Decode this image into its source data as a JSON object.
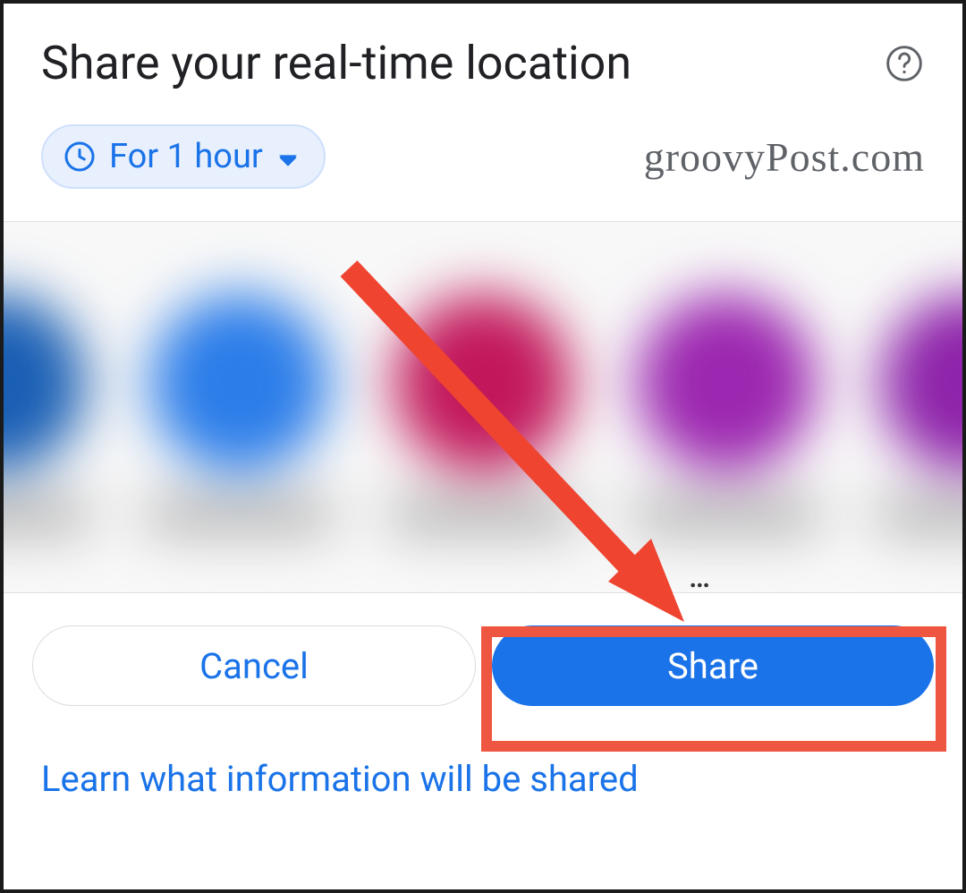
{
  "header": {
    "title": "Share your real-time location"
  },
  "duration": {
    "label": "For 1 hour"
  },
  "watermark": "groovyPost.com",
  "contacts": [
    {
      "color": "#1a5fb4"
    },
    {
      "color": "#2b7de9"
    },
    {
      "color": "#c2185b"
    },
    {
      "color": "#9c27b0"
    },
    {
      "color": "#8e24aa"
    }
  ],
  "buttons": {
    "cancel": "Cancel",
    "share": "Share"
  },
  "learn_link": "Learn what information will be shared"
}
